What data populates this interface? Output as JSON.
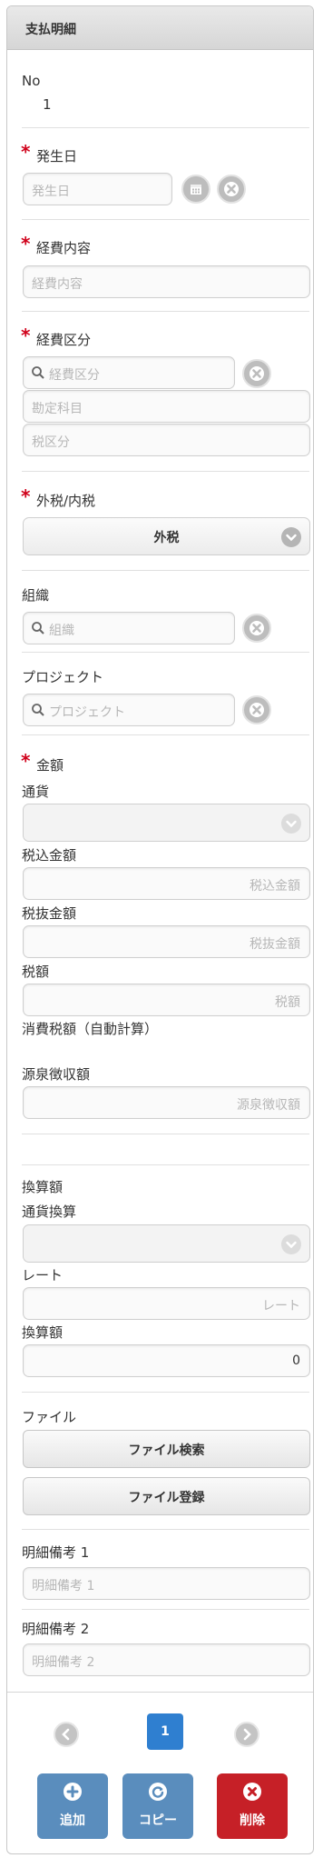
{
  "header": {
    "title": "支払明細"
  },
  "no": {
    "label": "No",
    "value": "1"
  },
  "occurrence_date": {
    "label": "発生日",
    "placeholder": "発生日"
  },
  "expense_content": {
    "label": "経費内容",
    "placeholder": "経費内容"
  },
  "expense_category": {
    "label": "経費区分",
    "placeholder": "経費区分",
    "account_placeholder": "勘定科目",
    "tax_category_placeholder": "税区分"
  },
  "tax_type": {
    "label": "外税/内税",
    "selected": "外税"
  },
  "organization": {
    "label": "組織",
    "placeholder": "組織"
  },
  "project": {
    "label": "プロジェクト",
    "placeholder": "プロジェクト"
  },
  "amount": {
    "label": "金額",
    "currency_label": "通貨",
    "tax_included_label": "税込金額",
    "tax_included_placeholder": "税込金額",
    "tax_excluded_label": "税抜金額",
    "tax_excluded_placeholder": "税抜金額",
    "tax_label": "税額",
    "tax_placeholder": "税額",
    "consumption_tax_label": "消費税額（自動計算）",
    "withholding_label": "源泉徴収額",
    "withholding_placeholder": "源泉徴収額"
  },
  "conversion": {
    "label": "換算額",
    "currency_conversion_label": "通貨換算",
    "rate_label": "レート",
    "rate_placeholder": "レート",
    "converted_label": "換算額",
    "converted_value": "0"
  },
  "file": {
    "label": "ファイル",
    "search_button": "ファイル検索",
    "register_button": "ファイル登録"
  },
  "remarks1": {
    "label": "明細備考 1",
    "placeholder": "明細備考 1"
  },
  "remarks2": {
    "label": "明細備考 2",
    "placeholder": "明細備考 2"
  },
  "pager": {
    "current": "1"
  },
  "actions": {
    "add": "追加",
    "copy": "コピー",
    "delete": "削除"
  },
  "colors": {
    "accent": "#2f7fd0",
    "action_blue": "#5a8dbd",
    "danger": "#c62027",
    "required": "#d0021b"
  }
}
